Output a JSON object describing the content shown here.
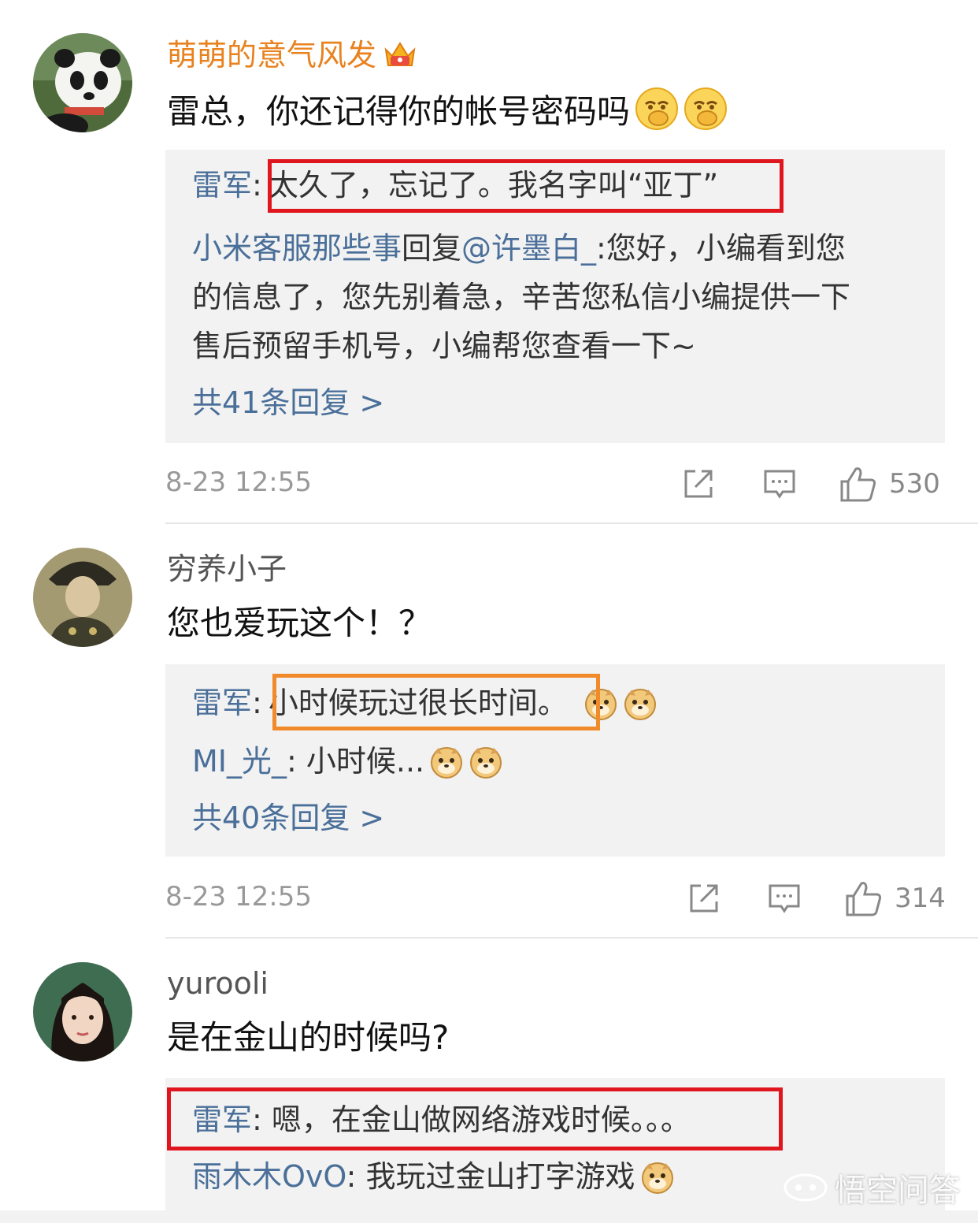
{
  "comments": [
    {
      "username": "萌萌的意气风发",
      "text": "雷总，你还记得你的帐号密码吗",
      "replies": {
        "line1_name": "雷军",
        "line1_sep": ":",
        "line1_text": "太久了，忘记了。我名字叫“亚丁”",
        "line2_name": "小米客服那些事",
        "line2_text_a": "回复",
        "line2_mention": "@许墨白_",
        "line2_text_b": ":您好，小编看到您",
        "line3_text": "的信息了，您先别着急，辛苦您私信小编提供一下",
        "line4_text": "售后预留手机号，小编帮您查看一下~",
        "more": "共41条回复 >"
      },
      "timestamp": "8-23 12:55",
      "likes": "530"
    },
    {
      "username": "穷养小子",
      "text": "您也爱玩这个！？",
      "replies": {
        "line1_name": "雷军",
        "line1_sep": ":",
        "line1_text": "小时候玩过很长时间。",
        "line2_name": "MI_光_",
        "line2_text": ": 小时候...",
        "more": "共40条回复 >"
      },
      "timestamp": "8-23 12:55",
      "likes": "314"
    },
    {
      "username": "yurooli",
      "text": "是在金山的时候吗?",
      "replies": {
        "line1_name": "雷军",
        "line1_text": ": 嗯，在金山做网络游戏时候。。。",
        "line2_name": "雨木木OvO",
        "line2_text": ": 我玩过金山打字游戏"
      }
    }
  ],
  "watermark": "悟空问答",
  "colors": {
    "vip_name": "#e8821f",
    "link": "#4a6f99",
    "highlight_red": "#e0161f",
    "highlight_orange": "#f08a2a",
    "reply_bg": "#f2f2f2"
  },
  "icons": [
    "vip-crown-icon",
    "smirk-emoji",
    "doge-emoji",
    "share-icon",
    "comment-icon",
    "thumbs-up-icon"
  ]
}
